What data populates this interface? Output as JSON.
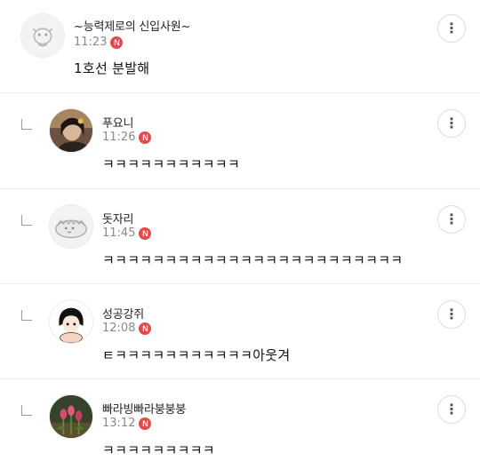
{
  "comments": [
    {
      "nickname": "~능력제로의 신입사원~",
      "time": "11:23",
      "badge": "N",
      "text": "1호선 분발해",
      "more_icon": "⋮"
    },
    {
      "nickname": "푸요니",
      "time": "11:26",
      "badge": "N",
      "text": "ㅋㅋㅋㅋㅋㅋㅋㅋㅋㅋㅋ",
      "more_icon": "⋮"
    },
    {
      "nickname": "돗자리",
      "time": "11:45",
      "badge": "N",
      "text": "ㅋㅋㅋㅋㅋㅋㅋㅋㅋㅋㅋㅋㅋㅋㅋㅋㅋㅋㅋㅋㅋㅋㅋㅋ",
      "more_icon": "⋮"
    },
    {
      "nickname": "성공강쥐",
      "time": "12:08",
      "badge": "N",
      "text": "ㅌㅋㅋㅋㅋㅋㅋㅋㅋㅋㅋㅋ아웃겨",
      "more_icon": "⋮"
    },
    {
      "nickname": "빠라빙빠라붕붕붕",
      "time": "13:12",
      "badge": "N",
      "text": "ㅋㅋㅋㅋㅋㅋㅋㅋㅋ",
      "more_icon": "⋮"
    }
  ],
  "colors": {
    "new_badge": "#e04b4b",
    "divider": "#ececec",
    "time": "#8a8a8a"
  }
}
